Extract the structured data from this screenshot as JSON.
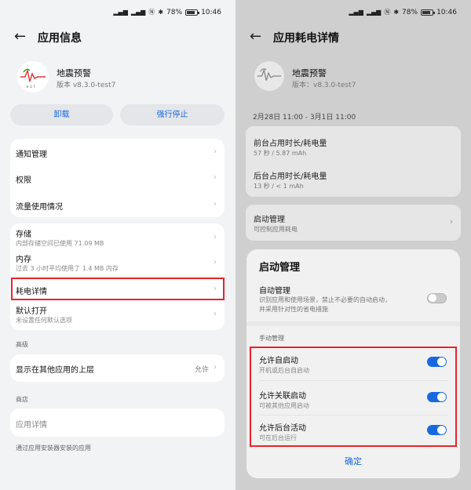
{
  "status": {
    "battery": "78%",
    "time": "10:46"
  },
  "left": {
    "title": "应用信息",
    "app": {
      "name": "地震预警",
      "version": "版本 v8.3.0-test7"
    },
    "buttons": {
      "uninstall": "卸载",
      "force_stop": "强行停止"
    },
    "group1": [
      {
        "title": "通知管理"
      },
      {
        "title": "权限"
      },
      {
        "title": "流量使用情况"
      }
    ],
    "group2": [
      {
        "title": "存储",
        "sub": "内部存储空间已使用 71.09 MB"
      },
      {
        "title": "内存",
        "sub": "过去 3 小时平均使用了 1.4 MB 内存"
      },
      {
        "title": "耗电详情"
      },
      {
        "title": "默认打开",
        "sub": "未设置任何默认选项"
      }
    ],
    "advanced": {
      "section": "高级",
      "overlay_title": "显示在其他应用的上层",
      "overlay_value": "允许"
    },
    "store": {
      "section": "商店",
      "details": "应用详情",
      "installer_note": "通过应用安装器安装的应用"
    }
  },
  "right": {
    "title": "应用耗电详情",
    "app": {
      "name": "地震预警",
      "version": "版本：v8.3.0-test7"
    },
    "date_range": "2月28日 11:00 - 3月1日 11:00",
    "usage": [
      {
        "title": "前台占用时长/耗电量",
        "value": "57 秒 / 5.87 mAh"
      },
      {
        "title": "后台占用时长/耗电量",
        "value": "13 秒 / < 1 mAh"
      }
    ],
    "startup": {
      "title": "启动管理",
      "sub": "可控制应用耗电"
    },
    "sheet": {
      "title": "启动管理",
      "auto_title": "自动管理",
      "auto_desc_1": "识别应用和使用场景，禁止不必要的自动启动，",
      "auto_desc_2": "并采用针对性的省电措施",
      "manual_section": "手动管理",
      "options": [
        {
          "title": "允许自启动",
          "sub": "开机或后台自启动"
        },
        {
          "title": "允许关联启动",
          "sub": "可被其他应用启动"
        },
        {
          "title": "允许后台活动",
          "sub": "可在后台运行"
        }
      ],
      "confirm": "确定"
    }
  }
}
